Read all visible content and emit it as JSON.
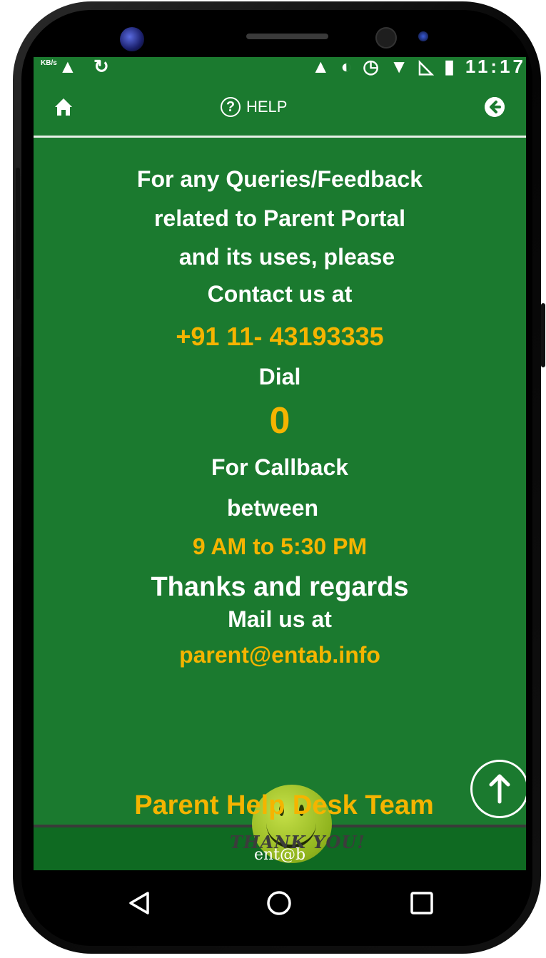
{
  "status_bar": {
    "speed": "KB/s",
    "left_icons": "▲ ↻",
    "right_icons": "▲ ◐ ◷ ▼ ◺ ▮ 11:17"
  },
  "toolbar": {
    "title": "HELP",
    "help_glyph": "?",
    "home_icon": "home-icon",
    "back_icon": "arrow-left-circle-icon"
  },
  "content": {
    "line1": "For any Queries/Feedback",
    "line2": "related to Parent Portal",
    "line3": "and its uses, please",
    "line4": "Contact us at",
    "phone": "+91 11- 43193335",
    "dial_label": "Dial",
    "dial_value": "0",
    "callback_label": "For Callback",
    "between_label": "between",
    "hours": "9 AM to 5:30 PM",
    "mail_label": "Mail us at",
    "email": "parent@entab.info",
    "thanks": "Thanks and regards",
    "team": "Parent Help Desk Team"
  },
  "footer": {
    "thank_you": "THANK YOU!",
    "brand": "ent@b"
  },
  "scroll_top_icon": "arrow-up-icon",
  "nav": {
    "back_icon": "triangle-back-icon",
    "home_icon": "circle-home-icon",
    "recents_icon": "square-recents-icon"
  },
  "colors": {
    "screen_green": "#1b7a2f",
    "accent_yellow": "#f5b400",
    "text_white": "#ffffff"
  }
}
